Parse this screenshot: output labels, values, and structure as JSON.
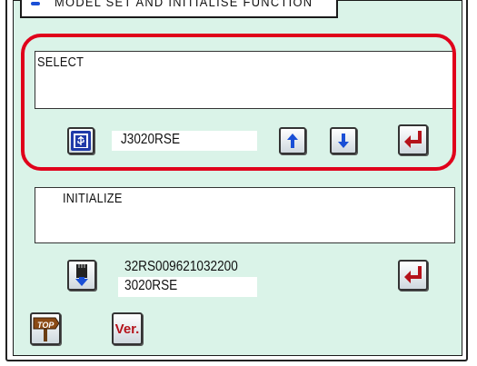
{
  "title": "MODEL SET AND INITIALISE FUNCTION",
  "select_panel": {
    "label": "SELECT",
    "model": "J3020RSE",
    "usb_icon": "usb-icon",
    "up_icon": "arrow-up-icon",
    "down_icon": "arrow-down-icon",
    "enter_icon": "enter-icon"
  },
  "initialize_panel": {
    "label": "INITIALIZE",
    "firmware_code": "32RS009621032200",
    "model": "3020RSE",
    "download_icon": "download-icon",
    "enter_icon": "enter-icon"
  },
  "footer": {
    "top_label": "TOP",
    "ver_label": "Ver."
  },
  "colors": {
    "screen_bg": "#daf3e8",
    "highlight": "#e0001b",
    "accent_blue": "#1a4fd6",
    "enter_red": "#b5121b"
  }
}
